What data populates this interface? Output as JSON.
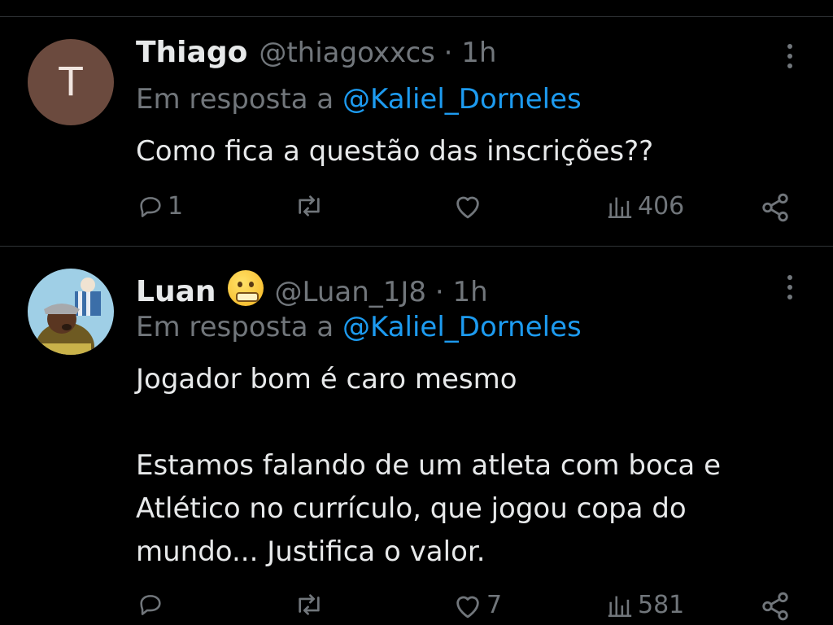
{
  "tweets": [
    {
      "name": "Thiago",
      "handle": "@thiagoxxcs · 1h",
      "avatar_letter": "T",
      "reply_prefix": "Em resposta a",
      "reply_mention": "@Kaliel_Dorneles",
      "body_lines": [
        "Como fica a questão das inscrições??"
      ],
      "reply_count": "1",
      "like_count": "",
      "view_count": "406"
    },
    {
      "name": "Luan",
      "handle": "@Luan_1J8 · 1h",
      "emoji": "zipper-mouth-face",
      "reply_prefix": "Em resposta a",
      "reply_mention": "@Kaliel_Dorneles",
      "body_lines": [
        "Jogador bom é caro mesmo",
        "",
        "Estamos falando de um atleta com boca e",
        "Atlético no currículo, que jogou copa do",
        "mundo... Justifica o valor."
      ],
      "reply_count": "",
      "like_count": "7",
      "view_count": "581"
    }
  ],
  "colors": {
    "background": "#000000",
    "text": "#e7e9ea",
    "muted": "#71767b",
    "link": "#1d9bf0",
    "divider": "#2f3336"
  },
  "icons": [
    "reply-icon",
    "retweet-icon",
    "like-icon",
    "views-icon",
    "share-icon",
    "more-icon"
  ]
}
